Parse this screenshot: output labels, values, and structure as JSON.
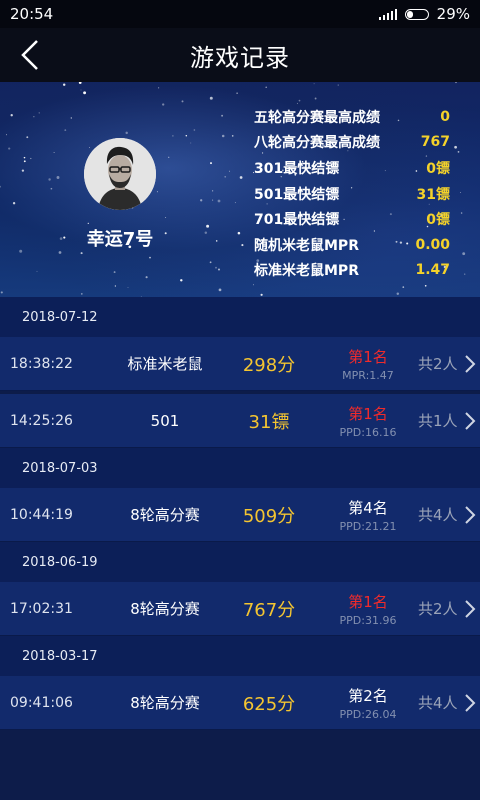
{
  "status_bar": {
    "time": "20:54",
    "battery": "29%"
  },
  "header": {
    "title": "游戏记录"
  },
  "profile": {
    "name": "幸运7号",
    "stats": [
      {
        "label": "五轮高分赛最高成绩",
        "value": "0"
      },
      {
        "label": "八轮高分赛最高成绩",
        "value": "767"
      },
      {
        "label": "301最快结镖",
        "value": "0镖"
      },
      {
        "label": "501最快结镖",
        "value": "31镖"
      },
      {
        "label": "701最快结镖",
        "value": "0镖"
      },
      {
        "label": "随机米老鼠MPR",
        "value": "0.00"
      },
      {
        "label": "标准米老鼠MPR",
        "value": "1.47"
      }
    ]
  },
  "groups": [
    {
      "date": "2018-07-12",
      "records": [
        {
          "time": "18:38:22",
          "mode": "标准米老鼠",
          "score": "298分",
          "rank": "第1名",
          "rank_is_first": true,
          "sub": "MPR:1.47",
          "players": "共2人"
        },
        {
          "time": "14:25:26",
          "mode": "501",
          "score": "31镖",
          "rank": "第1名",
          "rank_is_first": true,
          "sub": "PPD:16.16",
          "players": "共1人"
        }
      ]
    },
    {
      "date": "2018-07-03",
      "records": [
        {
          "time": "10:44:19",
          "mode": "8轮高分赛",
          "score": "509分",
          "rank": "第4名",
          "rank_is_first": false,
          "sub": "PPD:21.21",
          "players": "共4人"
        }
      ]
    },
    {
      "date": "2018-06-19",
      "records": [
        {
          "time": "17:02:31",
          "mode": "8轮高分赛",
          "score": "767分",
          "rank": "第1名",
          "rank_is_first": true,
          "sub": "PPD:31.96",
          "players": "共2人"
        }
      ]
    },
    {
      "date": "2018-03-17",
      "records": [
        {
          "time": "09:41:06",
          "mode": "8轮高分赛",
          "score": "625分",
          "rank": "第2名",
          "rank_is_first": false,
          "sub": "PPD:26.04",
          "players": "共4人"
        }
      ]
    }
  ],
  "colors": {
    "accent_gold": "#f4c531",
    "first_place_red": "#ef2b2b",
    "row_bg": "#122a6c"
  }
}
